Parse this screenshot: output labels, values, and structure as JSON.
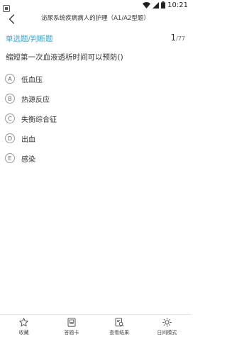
{
  "status_bar": {
    "time": "10:21"
  },
  "header": {
    "title": "泌尿系统疾病病人的护理（A1/A2型题）"
  },
  "question": {
    "type_label": "单选题/判断题",
    "current": "1",
    "total": "/77",
    "text": "缩短第一次血液透析时间可以预防()",
    "options": [
      {
        "letter": "A",
        "text": "低血压"
      },
      {
        "letter": "B",
        "text": "热源反应"
      },
      {
        "letter": "C",
        "text": "失衡综合征"
      },
      {
        "letter": "D",
        "text": "出血"
      },
      {
        "letter": "E",
        "text": "感染"
      }
    ]
  },
  "bottom_bar": {
    "tabs": [
      {
        "label": "收藏",
        "icon": "star-icon"
      },
      {
        "label": "答题卡",
        "icon": "answer-card-icon"
      },
      {
        "label": "查看结果",
        "icon": "view-results-icon"
      },
      {
        "label": "日间模式",
        "icon": "sun-icon"
      }
    ]
  },
  "colors": {
    "accent": "#2aa7d6",
    "text": "#333333",
    "divider": "#e6e6e6"
  }
}
